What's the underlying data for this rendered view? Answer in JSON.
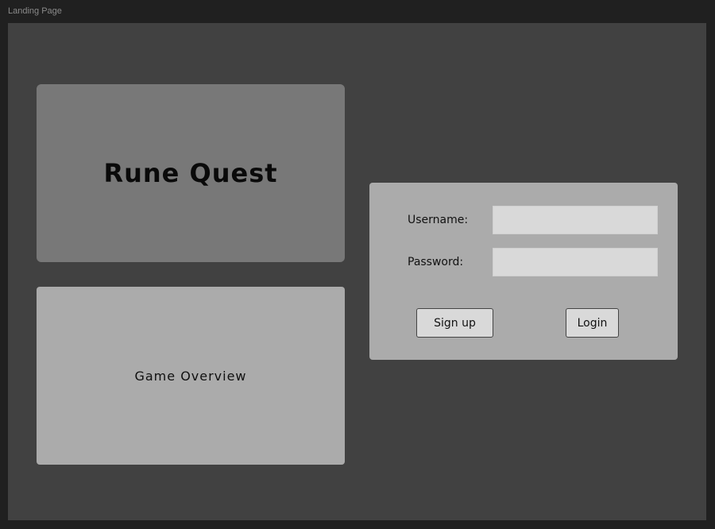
{
  "window": {
    "title": "Landing Page"
  },
  "title_card": {
    "title": "Rune Quest"
  },
  "overview_card": {
    "label": "Game Overview"
  },
  "login": {
    "username_label": "Username:",
    "username_value": "",
    "password_label": "Password:",
    "password_value": "",
    "signup_label": "Sign up",
    "login_label": "Login"
  },
  "colors": {
    "frame_bg": "#414141",
    "title_card_bg": "#787878",
    "panel_bg": "#ababab",
    "input_bg": "#d9d9d9"
  }
}
